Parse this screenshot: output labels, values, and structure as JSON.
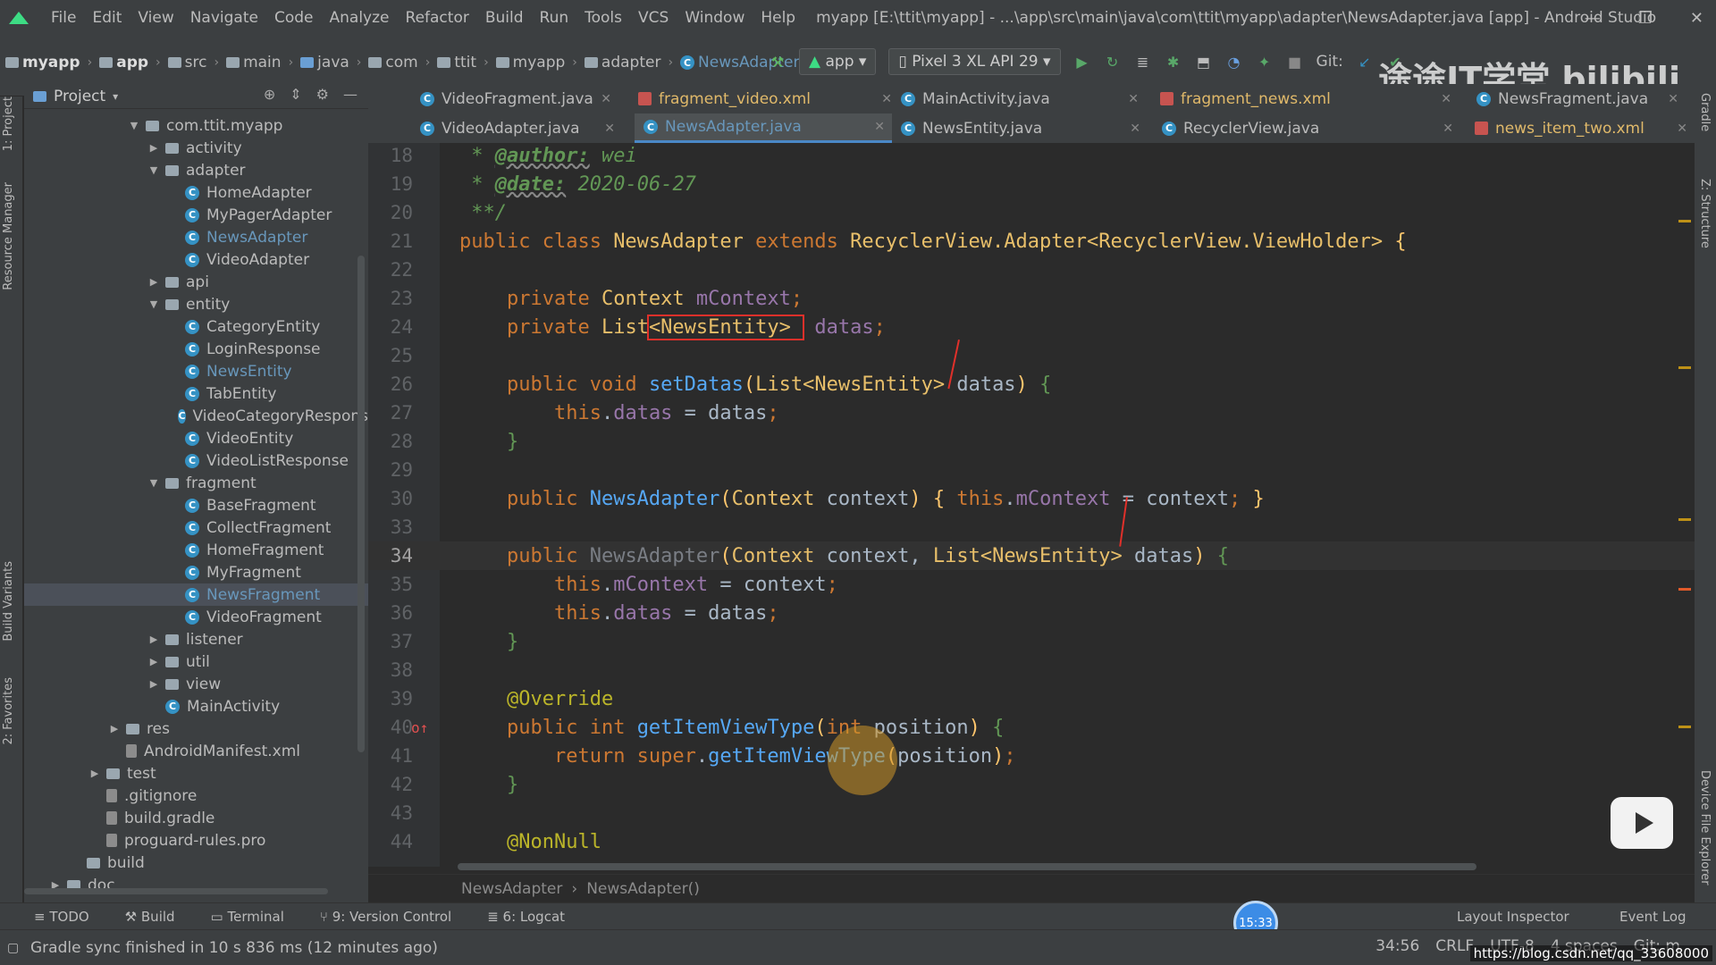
{
  "menu": [
    "File",
    "Edit",
    "View",
    "Navigate",
    "Code",
    "Analyze",
    "Refactor",
    "Build",
    "Run",
    "Tools",
    "VCS",
    "Window",
    "Help"
  ],
  "window_title": "myapp [E:\\ttit\\myapp] - ...\\app\\src\\main\\java\\com\\ttit\\myapp\\adapter\\NewsAdapter.java [app] - Android Studio",
  "breadcrumb": [
    "myapp",
    "app",
    "src",
    "main",
    "java",
    "com",
    "ttit",
    "myapp",
    "adapter",
    "NewsAdapter"
  ],
  "toolbar": {
    "config": "app",
    "device": "Pixel 3 XL API 29",
    "git_label": "Git:"
  },
  "watermark": "途途IT学堂 bilibili",
  "left_tabs": [
    "1: Project",
    "Resource Manager",
    "Build Variants",
    "2: Favorites"
  ],
  "right_tabs": [
    "Gradle",
    "Z: Structure",
    "Device File Explorer"
  ],
  "project": {
    "title": "Project",
    "tree": [
      {
        "label": "com.ttit.myapp",
        "indent": 2,
        "arrow": "down",
        "icon": "folder"
      },
      {
        "label": "activity",
        "indent": 3,
        "arrow": "right",
        "icon": "folder"
      },
      {
        "label": "adapter",
        "indent": 3,
        "arrow": "down",
        "icon": "folder"
      },
      {
        "label": "HomeAdapter",
        "indent": 4,
        "icon": "class"
      },
      {
        "label": "MyPagerAdapter",
        "indent": 4,
        "icon": "class"
      },
      {
        "label": "NewsAdapter",
        "indent": 4,
        "icon": "class",
        "modified": true
      },
      {
        "label": "VideoAdapter",
        "indent": 4,
        "icon": "class"
      },
      {
        "label": "api",
        "indent": 3,
        "arrow": "right",
        "icon": "folder"
      },
      {
        "label": "entity",
        "indent": 3,
        "arrow": "down",
        "icon": "folder"
      },
      {
        "label": "CategoryEntity",
        "indent": 4,
        "icon": "class"
      },
      {
        "label": "LoginResponse",
        "indent": 4,
        "icon": "class"
      },
      {
        "label": "NewsEntity",
        "indent": 4,
        "icon": "class",
        "modified": true
      },
      {
        "label": "TabEntity",
        "indent": 4,
        "icon": "class"
      },
      {
        "label": "VideoCategoryRespons",
        "indent": 4,
        "icon": "class"
      },
      {
        "label": "VideoEntity",
        "indent": 4,
        "icon": "class"
      },
      {
        "label": "VideoListResponse",
        "indent": 4,
        "icon": "class"
      },
      {
        "label": "fragment",
        "indent": 3,
        "arrow": "down",
        "icon": "folder"
      },
      {
        "label": "BaseFragment",
        "indent": 4,
        "icon": "class"
      },
      {
        "label": "CollectFragment",
        "indent": 4,
        "icon": "class"
      },
      {
        "label": "HomeFragment",
        "indent": 4,
        "icon": "class"
      },
      {
        "label": "MyFragment",
        "indent": 4,
        "icon": "class"
      },
      {
        "label": "NewsFragment",
        "indent": 4,
        "icon": "class",
        "modified": true,
        "selected": true
      },
      {
        "label": "VideoFragment",
        "indent": 4,
        "icon": "class"
      },
      {
        "label": "listener",
        "indent": 3,
        "arrow": "right",
        "icon": "folder"
      },
      {
        "label": "util",
        "indent": 3,
        "arrow": "right",
        "icon": "folder"
      },
      {
        "label": "view",
        "indent": 3,
        "arrow": "right",
        "icon": "folder"
      },
      {
        "label": "MainActivity",
        "indent": 3,
        "icon": "class"
      },
      {
        "label": "res",
        "indent": 1,
        "arrow": "right",
        "icon": "folder"
      },
      {
        "label": "AndroidManifest.xml",
        "indent": 1,
        "icon": "file"
      },
      {
        "label": "test",
        "indent": 0,
        "arrow": "right",
        "icon": "folder"
      },
      {
        "label": ".gitignore",
        "indent": 0,
        "icon": "file"
      },
      {
        "label": "build.gradle",
        "indent": 0,
        "icon": "file"
      },
      {
        "label": "proguard-rules.pro",
        "indent": 0,
        "icon": "file"
      },
      {
        "label": "build",
        "indent": -1,
        "icon": "folder"
      },
      {
        "label": "doc",
        "indent": -2,
        "arrow": "right",
        "icon": "folder"
      }
    ]
  },
  "tabs_row1": [
    {
      "label": "VideoFragment.java",
      "type": "class"
    },
    {
      "label": "fragment_video.xml",
      "type": "xml"
    },
    {
      "label": "MainActivity.java",
      "type": "class"
    },
    {
      "label": "fragment_news.xml",
      "type": "xml"
    },
    {
      "label": "NewsFragment.java",
      "type": "class"
    }
  ],
  "tabs_row2": [
    {
      "label": "VideoAdapter.java",
      "type": "class"
    },
    {
      "label": "NewsAdapter.java",
      "type": "class",
      "active": true
    },
    {
      "label": "NewsEntity.java",
      "type": "class"
    },
    {
      "label": "RecyclerView.java",
      "type": "class"
    },
    {
      "label": "news_item_two.xml",
      "type": "xml"
    }
  ],
  "line_numbers": [
    "18",
    "19",
    "20",
    "21",
    "22",
    "23",
    "24",
    "25",
    "26",
    "27",
    "28",
    "29",
    "30",
    "33",
    "34",
    "35",
    "36",
    "37",
    "38",
    "39",
    "40",
    "41",
    "42",
    "43",
    "44"
  ],
  "current_line": "34",
  "editor_breadcrumb": [
    "NewsAdapter",
    "NewsAdapter()"
  ],
  "bottom_tools": [
    "TODO",
    "Build",
    "Terminal",
    "9: Version Control",
    "6: Logcat"
  ],
  "bottom_tools_right": [
    "Layout Inspector",
    "Event Log"
  ],
  "status": {
    "message": "Gradle sync finished in 10 s 836 ms (12 minutes ago)",
    "position": "34:56",
    "line_sep": "CRLF",
    "encoding": "UTF-8",
    "indent": "4 spaces",
    "git": "Git: m"
  },
  "timer": "15:33",
  "url": "https://blog.csdn.net/qq_33608000"
}
